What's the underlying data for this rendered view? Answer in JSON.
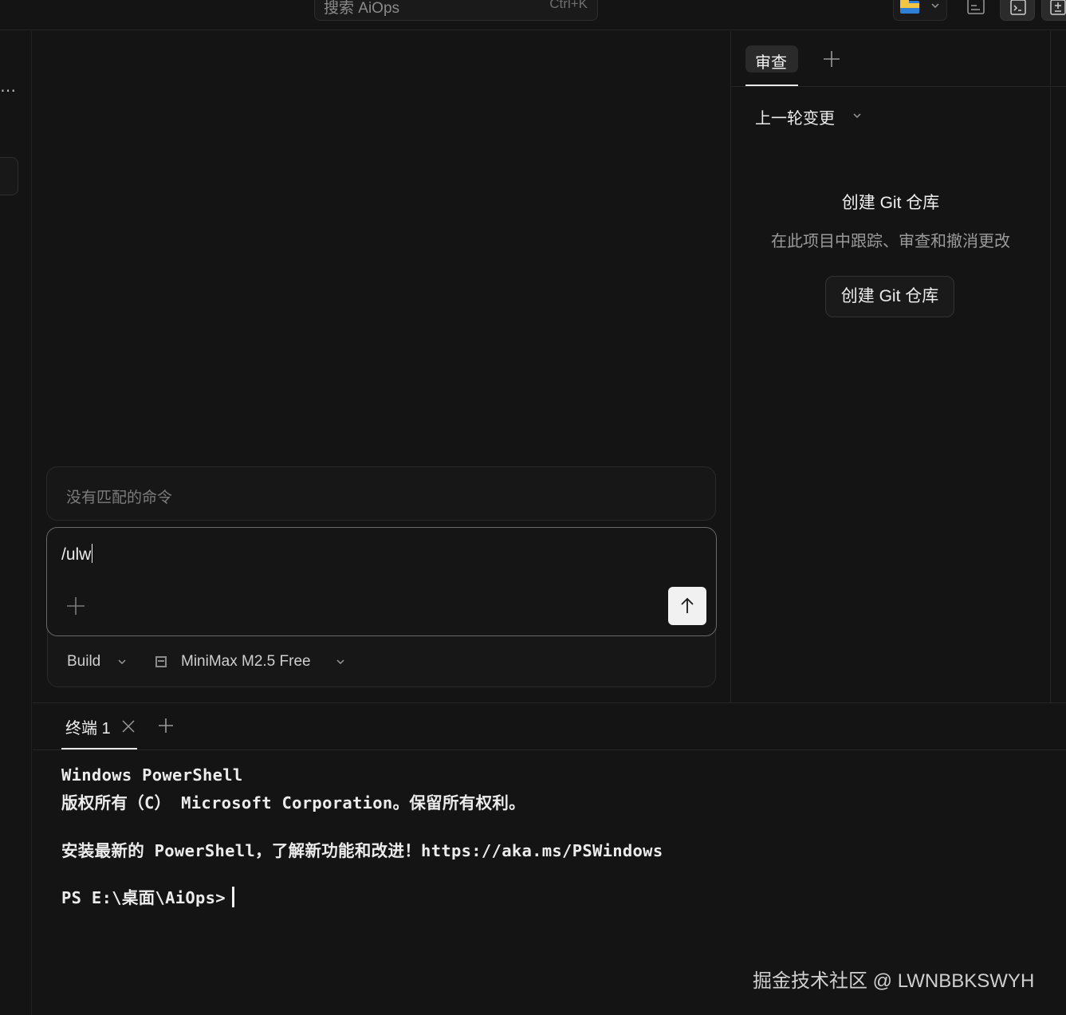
{
  "titlebar": {
    "search_label": "搜索 AiOps",
    "search_shortcut": "Ctrl+K"
  },
  "chat": {
    "no_match": "没有匹配的命令",
    "input_value": "/ulw",
    "mode": "Build",
    "model": "MiniMax M2.5 Free"
  },
  "review": {
    "tab_label": "审查",
    "changes_select": "上一轮变更",
    "git_title": "创建 Git 仓库",
    "git_desc": "在此项目中跟踪、审查和撤消更改",
    "git_button": "创建 Git 仓库"
  },
  "terminal": {
    "tab_label": "终端 1",
    "lines": [
      "Windows PowerShell",
      "版权所有（C） Microsoft Corporation。保留所有权利。",
      "",
      "安装最新的 PowerShell，了解新功能和改进！https://aka.ms/PSWindows",
      "",
      "PS E:\\桌面\\AiOps>"
    ]
  },
  "watermark": "掘金技术社区 @ LWNBBKSWYH",
  "colors": {
    "background": "#141414",
    "panel_border": "#262626",
    "accent_light": "#f1f1f1"
  }
}
